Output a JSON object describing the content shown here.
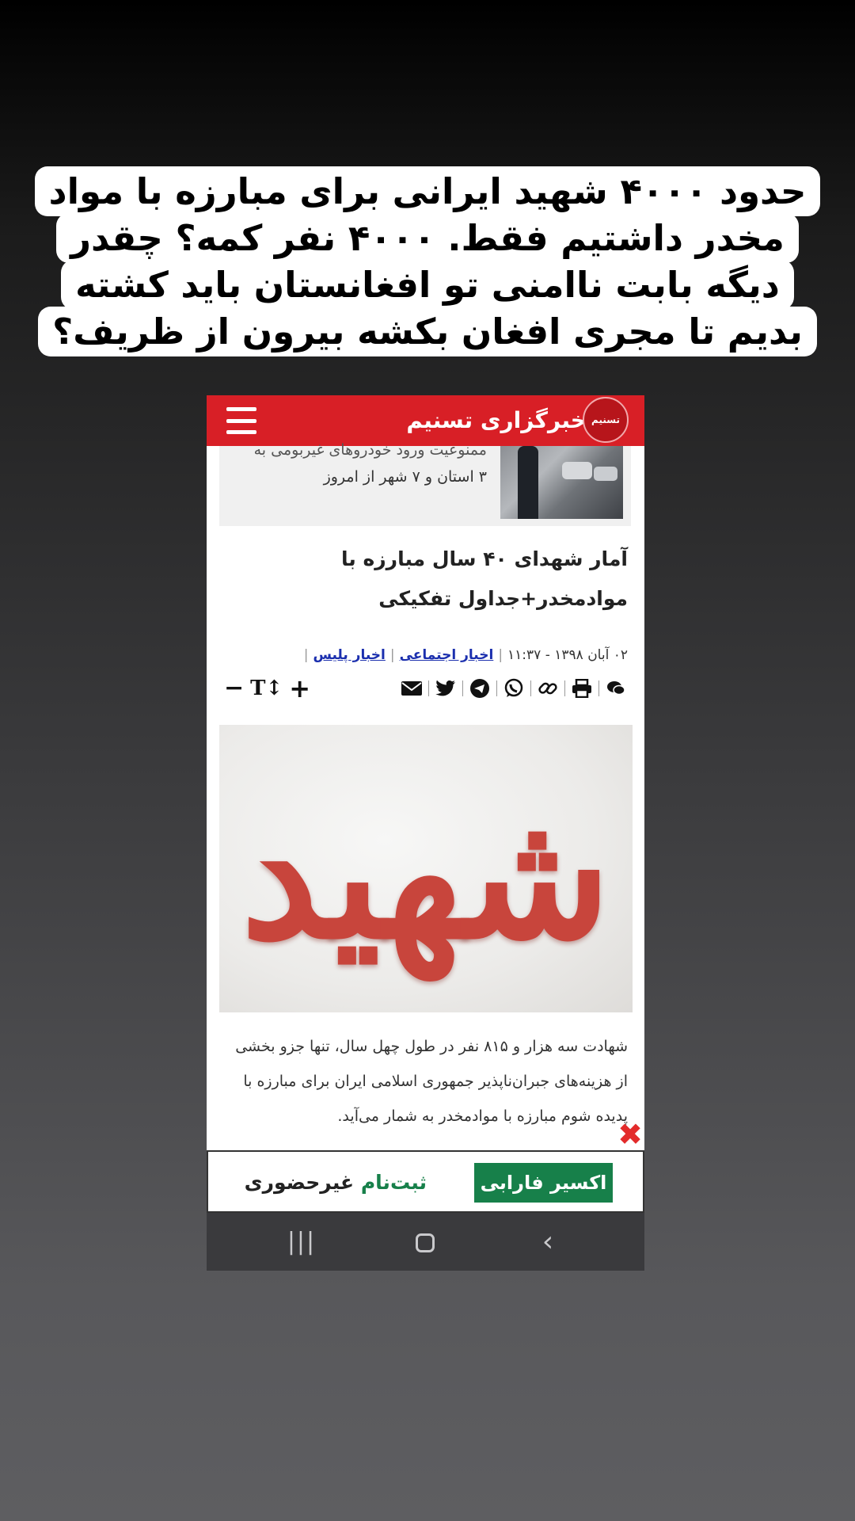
{
  "caption": {
    "lines": [
      "حدود ۴۰۰۰ شهید ایرانی برای مبارزه با مواد",
      "مخدر داشتیم فقط. ۴۰۰۰ نفر کمه؟ چقدر",
      "دیگه بابت ناامنی تو افغانستان باید کشته",
      "بدیم تا مجری افغان بکشه بیرون از ظریف؟"
    ]
  },
  "header": {
    "brand": "خبرگزاری تسنیم",
    "logo_glyph": "تسنیم",
    "menu_icon": "hamburger-icon"
  },
  "slider": {
    "lines": [
      "ممنوعیت ورود خودروهای غیربومی به",
      "۳ استان و ۷ شهر از امروز"
    ],
    "prev": "‹",
    "next": "›"
  },
  "article": {
    "title": "آمار شهدای ۴۰ سال مبارزه با موادمخدر+جداول تفکیکی",
    "date": "۰۲ آبان ۱۳۹۸ - ۱۱:۳۷",
    "categories": [
      "اخبار اجتماعی",
      "اخبار پلیس"
    ],
    "share_icons": [
      "comment-icon",
      "print-icon",
      "link-icon",
      "whatsapp-icon",
      "telegram-icon",
      "twitter-icon",
      "email-icon"
    ],
    "font_minus": "−",
    "font_label": "T↕",
    "font_plus": "+",
    "photo_word": "شهید",
    "body": "شهادت سه هزار و ۸۱۵ نفر در طول چهل سال، تنها جزو بخشی از هزینه‌های جبران‌ناپذیر جمهوری اسلامی ایران برای مبارزه با پدیده شوم مبارزه با موادمخدر به شمار می‌آید."
  },
  "ad": {
    "close": "✖",
    "badge": "اکسیر فارابی",
    "text_green": "ثبت‌نام",
    "text_dark": "غیرحضوری"
  },
  "navbar": {
    "recent": "|||",
    "back": "‹"
  },
  "colors": {
    "header_red": "#d81f26",
    "link_blue": "#1b2fae",
    "ad_green": "#17804a",
    "navbar": "#3a3a3d"
  }
}
